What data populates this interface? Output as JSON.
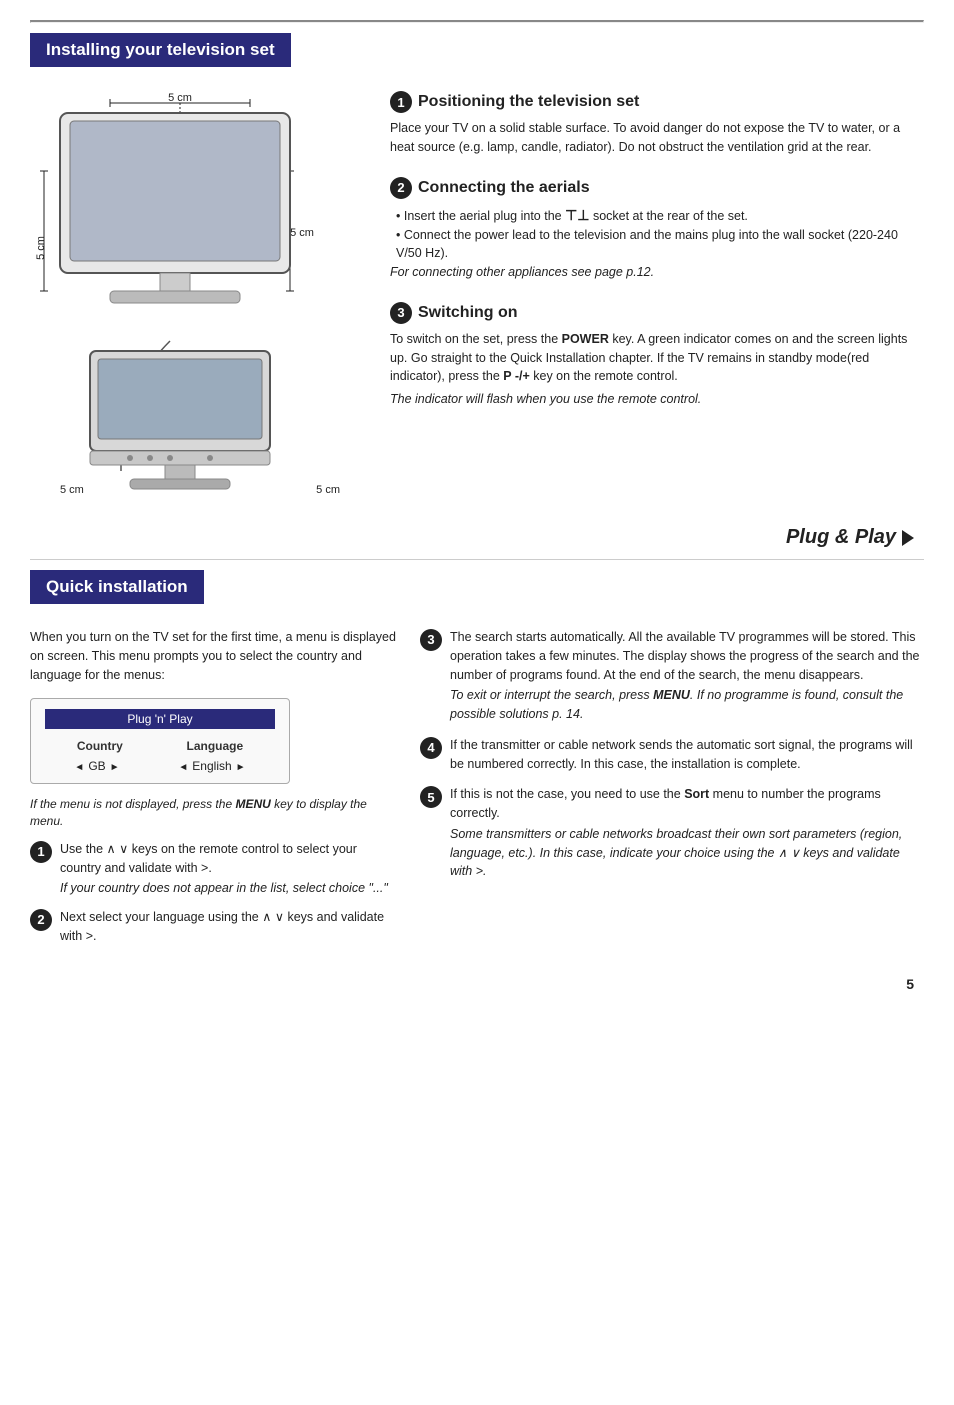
{
  "page": {
    "number": "5"
  },
  "section1": {
    "title": "Installing your television set",
    "measurements": {
      "top": "5 cm",
      "left": "5 cm",
      "right": "5 cm"
    },
    "positioning": {
      "number": "1",
      "heading": "Positioning the television set",
      "text": "Place your TV on a solid stable surface. To avoid danger do not expose the TV to water, or a heat source (e.g. lamp, candle, radiator). Do not obstruct the ventilation grid at the rear."
    },
    "connecting_aerials": {
      "number": "2",
      "heading": "Connecting the aerials",
      "bullet1": "Insert the aerial plug into the ⊤⊥ socket at the rear of the set.",
      "bullet2": "Connect the power lead to the television and the mains plug into the wall socket (220-240 V/50 Hz).",
      "note": "For connecting other appliances see page p.12."
    },
    "switching_on": {
      "number": "3",
      "heading": "Switching on",
      "text": "To switch on the set, press the POWER key. A green indicator comes on and the screen lights up. Go straight to the Quick Installation chapter. If the TV remains in standby mode(red indicator), press the P -/+ key on the remote control.",
      "note": "The indicator will flash when you use the remote control."
    }
  },
  "plug_play": {
    "label": "Plug & Play"
  },
  "section2": {
    "title": "Quick installation",
    "intro": "When you turn on the TV set for the first time, a menu is displayed on screen. This menu prompts you to select the country and language for the menus:",
    "menu_box": {
      "title": "Plug 'n' Play",
      "col1_header": "Country",
      "col2_header": "Language",
      "col1_value": "GB",
      "col2_value": "English"
    },
    "menu_caption": "If the menu is not displayed, press the MENU key to display the menu.",
    "steps_left": [
      {
        "number": "1",
        "text": "Use the ∧ ∨ keys on the remote control to select your country and validate with >.",
        "note": "If your country does not appear in the list, select choice \"...\""
      },
      {
        "number": "2",
        "text": "Next select your language using the ∧ ∨ keys and validate with >."
      }
    ],
    "steps_right": [
      {
        "number": "3",
        "text": "The search starts automatically. All the available TV programmes will be stored. This operation takes a few minutes. The display shows the progress of the search and the number of programs found. At the end of the search, the menu disappears.",
        "note": "To exit or interrupt the search, press MENU. If no programme is found, consult the possible solutions p. 14."
      },
      {
        "number": "4",
        "text": "If the transmitter or cable network sends the automatic sort signal, the programs will be numbered correctly. In this case, the installation is complete."
      },
      {
        "number": "5",
        "text": "If this is not the case, you need to use the Sort menu to number the programs correctly.",
        "note": "Some transmitters or cable networks broadcast their own sort parameters (region, language, etc.). In this case, indicate your choice using the ∧ ∨ keys and validate with >."
      }
    ]
  }
}
